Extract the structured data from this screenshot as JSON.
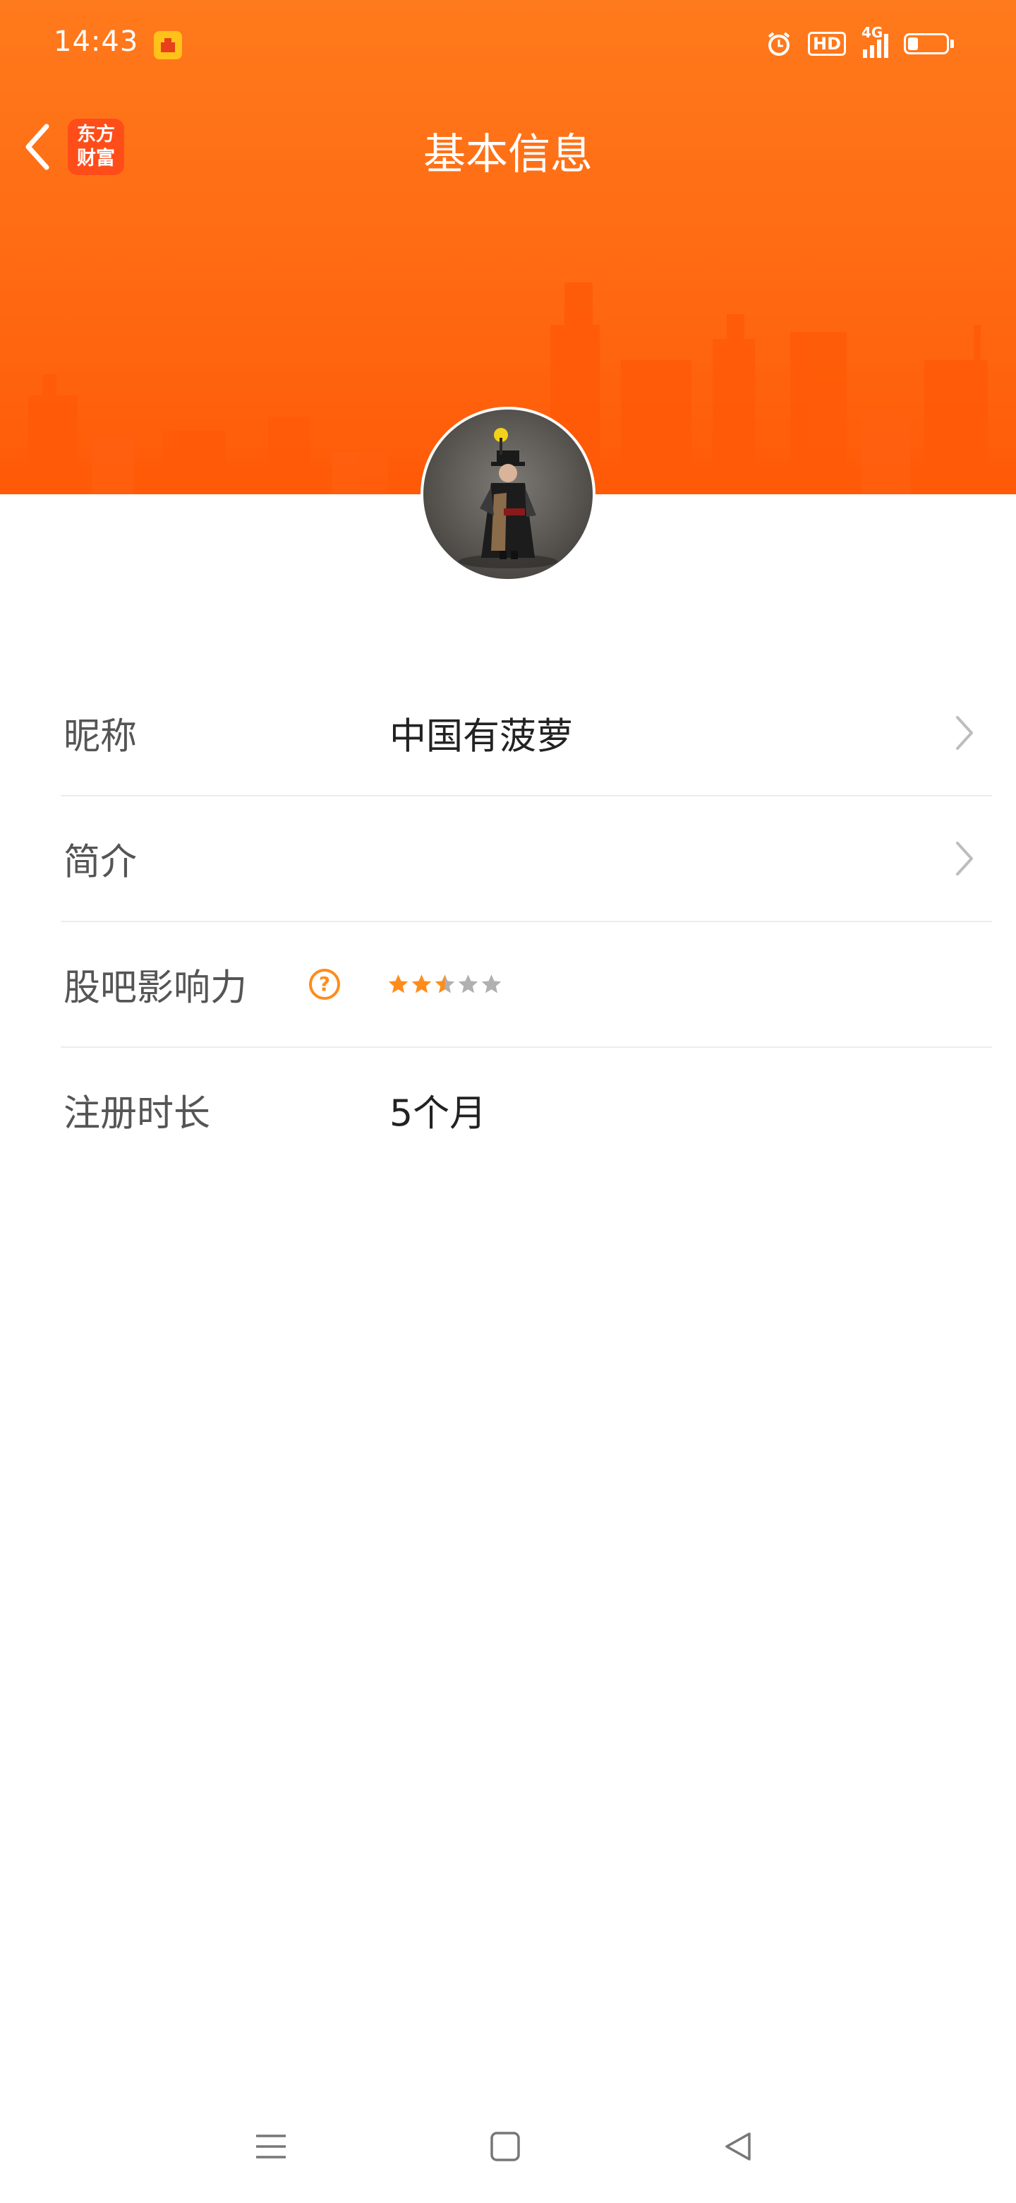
{
  "status_bar": {
    "time": "14:43",
    "hd_label": "HD",
    "network_label": "4G"
  },
  "topbar": {
    "logo_line1": "东方",
    "logo_line2": "财富",
    "title": "基本信息"
  },
  "profile": {
    "rows": [
      {
        "label": "昵称",
        "value": "中国有菠萝"
      },
      {
        "label": "简介",
        "value": ""
      },
      {
        "label": "股吧影响力",
        "help_symbol": "?",
        "rating": 2.5,
        "rating_max": 5
      },
      {
        "label": "注册时长",
        "value": "5个月"
      }
    ]
  },
  "colors": {
    "header_orange": "#ff6a12",
    "star_active": "#ff8c1a",
    "star_inactive": "#b0b0b0"
  }
}
